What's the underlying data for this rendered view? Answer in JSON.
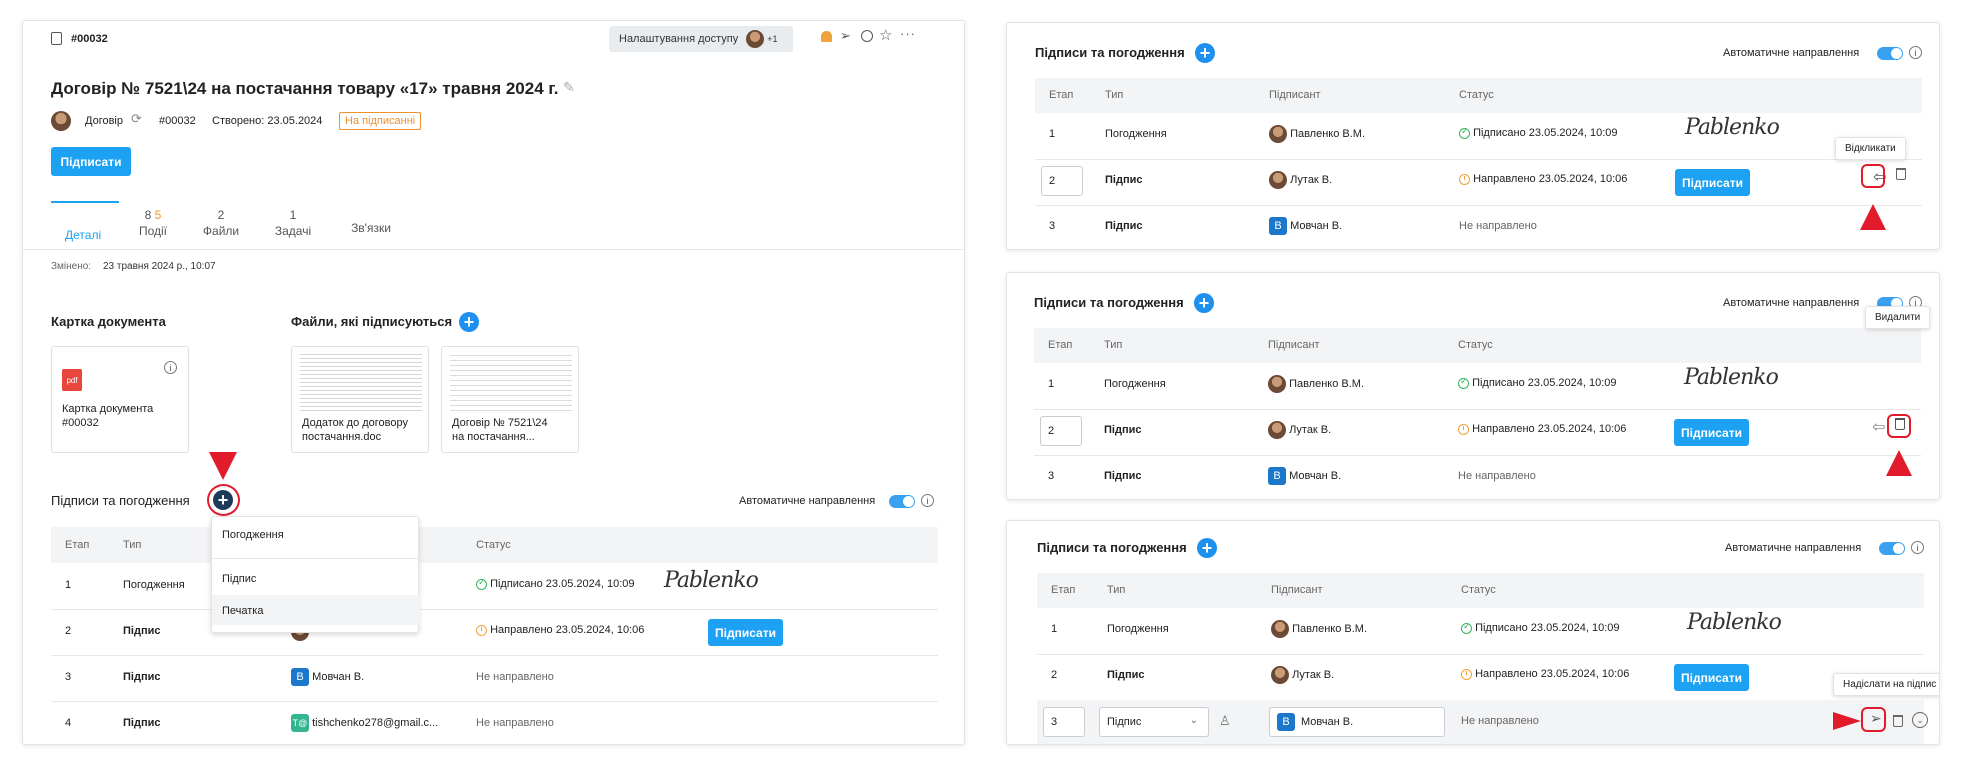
{
  "doc": {
    "id": "#00032",
    "access_button": "Налаштування доступу",
    "access_extra": "+1",
    "title": "Договір № 7521\\24 на постачання товару «17» травня 2024 г.",
    "type_label": "Договір",
    "doc_number": "#00032",
    "created": "Створено: 23.05.2024",
    "status_badge": "На підписанні",
    "sign_button": "Підписати",
    "tabs": [
      {
        "count": "",
        "count2": "",
        "label": "Деталі"
      },
      {
        "count": "8",
        "count2": "5",
        "label": "Події"
      },
      {
        "count": "2",
        "count2": "",
        "label": "Файли"
      },
      {
        "count": "1",
        "count2": "",
        "label": "Задачі"
      },
      {
        "count": "",
        "count2": "",
        "label": "Зв'язки"
      }
    ],
    "changed_label": "Змінено:",
    "changed_value": "23 травня 2024 р., 10:07",
    "card_section_title": "Картка документа",
    "card_tile_label": "Картка документа",
    "card_tile_number": "#00032",
    "pdf_label": "pdf",
    "files_section_title": "Файли, які підписуються",
    "files": [
      {
        "name_line1": "Додаток до договору",
        "name_line2": "постачання.doc"
      },
      {
        "name_line1": "Договір № 7521\\24",
        "name_line2": "на постачання..."
      }
    ]
  },
  "signatures": {
    "title": "Підписи та погодження",
    "auto_label": "Автоматичне направлення",
    "headers": {
      "stage": "Етап",
      "type": "Тип",
      "signer": "Підписант",
      "status": "Статус"
    },
    "dropdown": [
      "Погодження",
      "Підпис",
      "Печатка"
    ],
    "rows": [
      {
        "stage": "1",
        "type": "Погодження",
        "signer": "Павленко В.М.",
        "status": "Підписано 23.05.2024, 10:09",
        "signature": "Pablenko"
      },
      {
        "stage": "2",
        "type": "Підпис",
        "signer": "Лутак В.",
        "status": "Направлено 23.05.2024, 10:06",
        "button": "Підписати"
      },
      {
        "stage": "3",
        "type": "Підпис",
        "signer": "Мовчан В.",
        "signer_initial": "B",
        "status": "Не направлено"
      },
      {
        "stage": "4",
        "type": "Підпис",
        "signer": "tishchenko278@gmail.c...",
        "signer_initial": "T@",
        "status": "Не направлено"
      }
    ]
  },
  "panels": [
    {
      "tooltip": "Відкликати"
    },
    {
      "tooltip": "Видалити"
    },
    {
      "tooltip": "Надіслати на підпис",
      "edit_type": "Підпис",
      "edit_signer": "Мовчан В."
    }
  ],
  "colors": {
    "accent": "#1da1f2",
    "annotation": "#e21b2c",
    "badge": "#f0922b"
  }
}
